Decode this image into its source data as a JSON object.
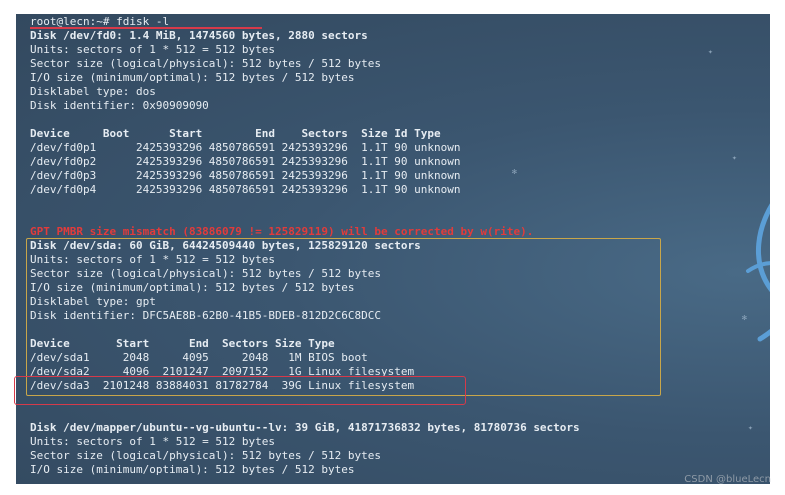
{
  "terminal": {
    "prompt_line": "root@lecn:~# fdisk -l",
    "fd0": {
      "header": "Disk /dev/fd0: 1.4 MiB, 1474560 bytes, 2880 sectors",
      "info": [
        "Units: sectors of 1 * 512 = 512 bytes",
        "Sector size (logical/physical): 512 bytes / 512 bytes",
        "I/O size (minimum/optimal): 512 bytes / 512 bytes",
        "Disklabel type: dos",
        "Disk identifier: 0x90909090"
      ],
      "table_header": "Device     Boot      Start        End    Sectors  Size Id Type",
      "rows": [
        "/dev/fd0p1      2425393296 4850786591 2425393296  1.1T 90 unknown",
        "/dev/fd0p2      2425393296 4850786591 2425393296  1.1T 90 unknown",
        "/dev/fd0p3      2425393296 4850786591 2425393296  1.1T 90 unknown",
        "/dev/fd0p4      2425393296 4850786591 2425393296  1.1T 90 unknown"
      ]
    },
    "warning": "GPT PMBR size mismatch (83886079 != 125829119) will be corrected by w(rite).",
    "sda": {
      "header": "Disk /dev/sda: 60 GiB, 64424509440 bytes, 125829120 sectors",
      "info": [
        "Units: sectors of 1 * 512 = 512 bytes",
        "Sector size (logical/physical): 512 bytes / 512 bytes",
        "I/O size (minimum/optimal): 512 bytes / 512 bytes",
        "Disklabel type: gpt",
        "Disk identifier: DFC5AE8B-62B0-41B5-BDEB-812D2C6C8DCC"
      ],
      "table_header": "Device       Start      End  Sectors Size Type",
      "rows": [
        "/dev/sda1     2048     4095     2048   1M BIOS boot",
        "/dev/sda2     4096  2101247  2097152   1G Linux filesystem",
        "/dev/sda3  2101248 83884031 81782784  39G Linux filesystem"
      ]
    },
    "lvm": {
      "header": "Disk /dev/mapper/ubuntu--vg-ubuntu--lv: 39 GiB, 41871736832 bytes, 81780736 sectors",
      "info": [
        "Units: sectors of 1 * 512 = 512 bytes",
        "Sector size (logical/physical): 512 bytes / 512 bytes",
        "I/O size (minimum/optimal): 512 bytes / 512 bytes"
      ]
    }
  },
  "watermark": "CSDN @blueLecn",
  "colors": {
    "annotation_red": "#d63a4a",
    "annotation_gold": "#c8a64a",
    "warning_text": "#e23b3b",
    "terminal_text": "#e6ecf2"
  }
}
